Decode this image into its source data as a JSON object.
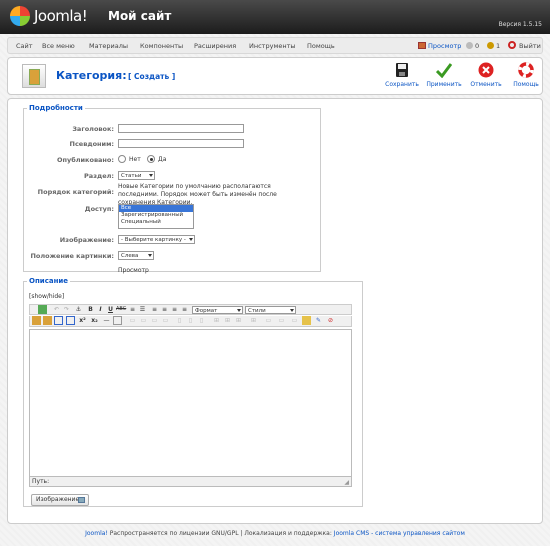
{
  "header": {
    "logo_text": "Joomla!",
    "site_name": "Мой сайт",
    "version": "Версия 1.5.15"
  },
  "menu": {
    "items": [
      "Сайт",
      "Все меню",
      "Материалы",
      "Компоненты",
      "Расширения",
      "Инструменты",
      "Помощь"
    ],
    "preview": "Просмотр",
    "messages_count": "0",
    "users_count": "1",
    "logout": "Выйти"
  },
  "toolbar": {
    "title": "Категория:",
    "subtitle": "[ Создать ]",
    "buttons": [
      {
        "label": "Сохранить",
        "icon": "save-icon"
      },
      {
        "label": "Применить",
        "icon": "apply-check-icon"
      },
      {
        "label": "Отменить",
        "icon": "cancel-icon"
      },
      {
        "label": "Помощь",
        "icon": "help-lifebuoy-icon"
      }
    ]
  },
  "details": {
    "legend": "Подробности",
    "title_label": "Заголовок:",
    "title_value": "",
    "alias_label": "Псевдоним:",
    "alias_value": "",
    "published_label": "Опубликовано:",
    "published_no": "Нет",
    "published_yes": "Да",
    "section_label": "Раздел:",
    "section_value": "Статьи",
    "order_label": "Порядок категорий:",
    "order_note": "Новые Категории по умолчанию располагаются последними. Порядок может быть изменён после сохранения Категории.",
    "access_label": "Доступ:",
    "access_options": [
      "Все",
      "Зарегистрированный",
      "Специальный"
    ],
    "image_label": "Изображение:",
    "image_value": "- Выберите картинку -",
    "image_pos_label": "Положение картинки:",
    "image_pos_value": "Слева",
    "preview_label": "Просмотр"
  },
  "description": {
    "legend": "Описание",
    "show_hide": "[show/hide]",
    "format_value": "Формат",
    "styles_value": "Стили",
    "path_label": "Путь:",
    "image_button": "Изображение"
  },
  "footer": {
    "joomla": "Joomla!",
    "license_text": " Распространяется по лицензии GNU/GPL | Локализация и поддержка: ",
    "link": "Joomla CMS - система управления сайтом"
  },
  "colors": {
    "accent": "#0b55c4",
    "header": "#2a2a2a",
    "apply": "#3a9a22",
    "cancel": "#d22"
  }
}
